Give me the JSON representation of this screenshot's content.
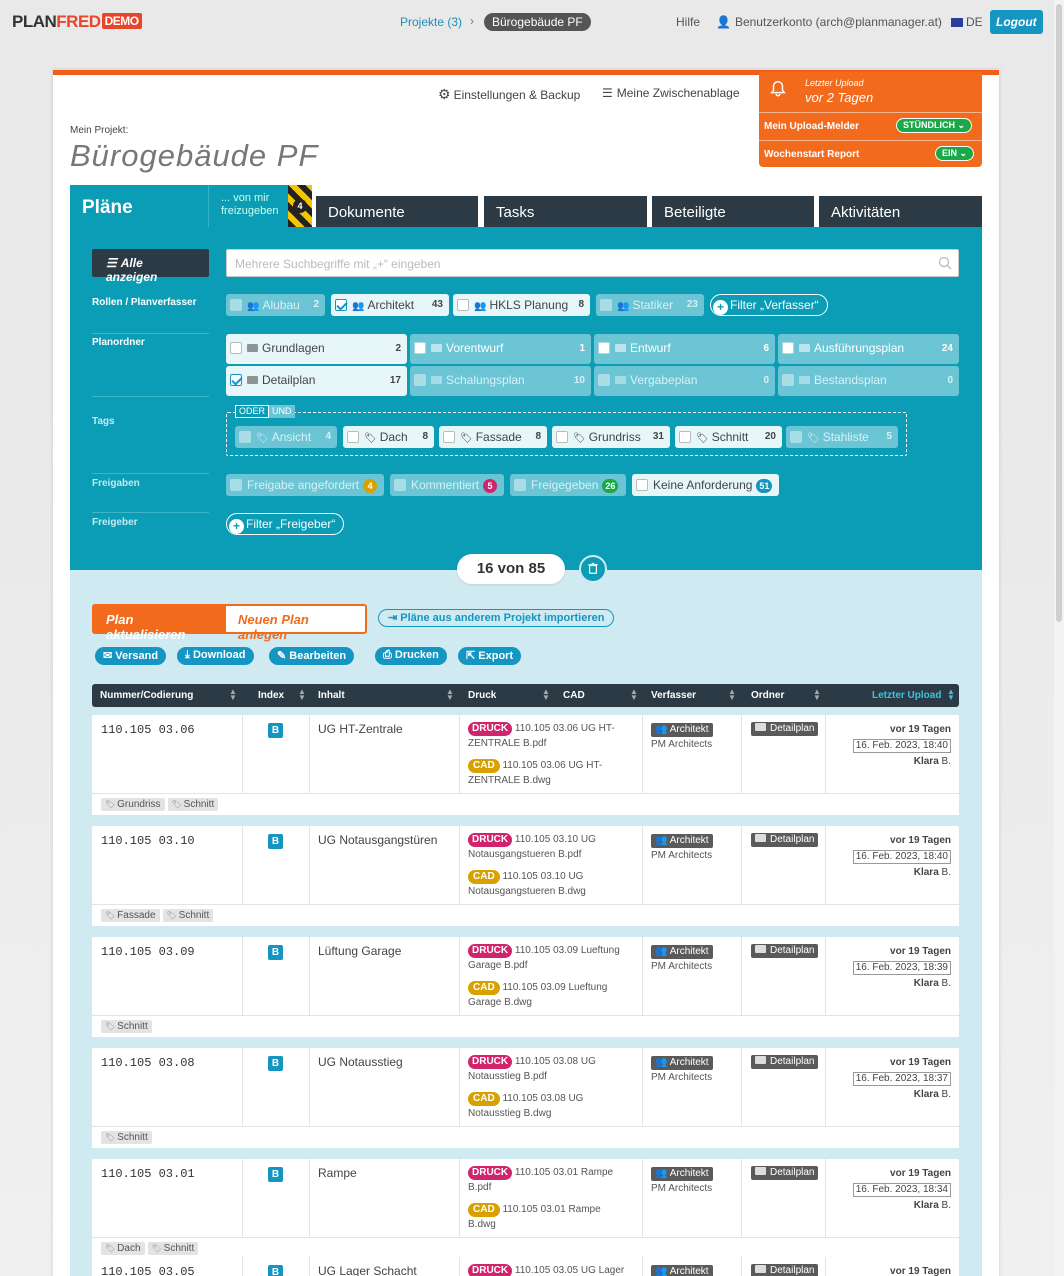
{
  "topbar": {
    "logo_a": "PLAN",
    "logo_b": "FRED",
    "logo_demo": "DEMO",
    "crumb_projects": "Projekte (3)",
    "crumb_current": "Bürogebäude PF",
    "help": "Hilfe",
    "account": "Benutzerkonto (arch@planmanager.at)",
    "lang": "DE",
    "logout": "Logout"
  },
  "toolbar": {
    "settings": "Einstellungen & Backup",
    "clipboard": "Meine Zwischenablage"
  },
  "notify": {
    "last_upload_label": "Letzter Upload",
    "last_upload_value": "vor 2 Tagen",
    "upload_alert_label": "Mein Upload-Melder",
    "upload_alert_value": "STÜNDLICH",
    "weekly_label": "Wochenstart Report",
    "weekly_value": "EIN"
  },
  "project": {
    "label": "Mein Projekt:",
    "title": "Bürogebäude PF"
  },
  "tabs": {
    "plans": "Pläne",
    "release_line1": "... von mir",
    "release_line2": "freizugeben",
    "release_count": "4",
    "documents": "Dokumente",
    "tasks": "Tasks",
    "participants": "Beteiligte",
    "activities": "Aktivitäten"
  },
  "filter": {
    "show_all": "Alle anzeigen",
    "search_placeholder": "Mehrere Suchbegriffe mit „+“ eingeben",
    "roles_label": "Rollen / Planverfasser",
    "roles": [
      {
        "label": "Alubau",
        "count": "2"
      },
      {
        "label": "Architekt",
        "count": "43"
      },
      {
        "label": "HKLS Planung",
        "count": "8"
      },
      {
        "label": "Statiker",
        "count": "23"
      }
    ],
    "add_author_filter": "Filter „Verfasser“",
    "folders_label": "Planordner",
    "folders": [
      {
        "label": "Grundlagen",
        "count": "2"
      },
      {
        "label": "Vorentwurf",
        "count": "1"
      },
      {
        "label": "Entwurf",
        "count": "6"
      },
      {
        "label": "Ausführungsplan",
        "count": "24"
      },
      {
        "label": "Detailplan",
        "count": "17"
      },
      {
        "label": "Schalungsplan",
        "count": "10"
      },
      {
        "label": "Vergabeplan",
        "count": "0"
      },
      {
        "label": "Bestandsplan",
        "count": "0"
      }
    ],
    "tags_label": "Tags",
    "oder": "ODER",
    "und": "UND",
    "tags": [
      {
        "label": "Ansicht",
        "count": "4"
      },
      {
        "label": "Dach",
        "count": "8"
      },
      {
        "label": "Fassade",
        "count": "8"
      },
      {
        "label": "Grundriss",
        "count": "31"
      },
      {
        "label": "Schnitt",
        "count": "20"
      },
      {
        "label": "Stahliste",
        "count": "5"
      }
    ],
    "releases_label": "Freigaben",
    "releases": [
      {
        "label": "Freigabe angefordert",
        "count": "4"
      },
      {
        "label": "Kommentiert",
        "count": "5"
      },
      {
        "label": "Freigegeben",
        "count": "26"
      },
      {
        "label": "Keine Anforderung",
        "count": "51"
      }
    ],
    "releaser_label": "Freigeber",
    "add_releaser_filter": "Filter „Freigeber“"
  },
  "counter": "16 von 85",
  "actions": {
    "update_plan": "Plan aktualisieren",
    "new_plan": "Neuen Plan anlegen",
    "import": "Pläne aus anderem Projekt importieren",
    "send": "Versand",
    "download": "Download",
    "edit": "Bearbeiten",
    "print": "Drucken",
    "export": "Export"
  },
  "table": {
    "headers": {
      "number": "Nummer/Codierung",
      "index": "Index",
      "content": "Inhalt",
      "print": "Druck",
      "cad": "CAD",
      "author": "Verfasser",
      "folder": "Ordner",
      "upload": "Letzter Upload"
    },
    "druck_label": "DRUCK",
    "cad_label": "CAD",
    "rows": [
      {
        "number": "110.105 03.06",
        "index": "B",
        "content": "UG HT-Zentrale",
        "pdf1": "110.105 03.06 UG HT-",
        "pdf2": "ZENTRALE B.pdf",
        "dwg1": "110.105 03.06 UG HT-",
        "dwg2": "ZENTRALE B.dwg",
        "role": "Architekt",
        "company": "PM Architects",
        "folder": "Detailplan",
        "ago": "vor 19 Tagen",
        "date": "16. Feb. 2023, 18:40",
        "user": "Klara",
        "user_b": "B.",
        "tags": [
          "Grundriss",
          "Schnitt"
        ]
      },
      {
        "number": "110.105 03.10",
        "index": "B",
        "content": "UG Notausgangstüren",
        "pdf1": "110.105 03.10 UG",
        "pdf2": "Notausgangstueren B.pdf",
        "dwg1": "110.105 03.10 UG",
        "dwg2": "Notausgangstueren B.dwg",
        "role": "Architekt",
        "company": "PM Architects",
        "folder": "Detailplan",
        "ago": "vor 19 Tagen",
        "date": "16. Feb. 2023, 18:40",
        "user": "Klara",
        "user_b": "B.",
        "tags": [
          "Fassade",
          "Schnitt"
        ]
      },
      {
        "number": "110.105 03.09",
        "index": "B",
        "content": "Lüftung Garage",
        "pdf1": "110.105 03.09 Lueftung",
        "pdf2": "Garage B.pdf",
        "dwg1": "110.105 03.09 Lueftung",
        "dwg2": "Garage B.dwg",
        "role": "Architekt",
        "company": "PM Architects",
        "folder": "Detailplan",
        "ago": "vor 19 Tagen",
        "date": "16. Feb. 2023, 18:39",
        "user": "Klara",
        "user_b": "B.",
        "tags": [
          "Schnitt"
        ]
      },
      {
        "number": "110.105 03.08",
        "index": "B",
        "content": "UG Notausstieg",
        "pdf1": "110.105 03.08 UG",
        "pdf2": "Notausstieg B.pdf",
        "dwg1": "110.105 03.08 UG",
        "dwg2": "Notausstieg B.dwg",
        "role": "Architekt",
        "company": "PM Architects",
        "folder": "Detailplan",
        "ago": "vor 19 Tagen",
        "date": "16. Feb. 2023, 18:37",
        "user": "Klara",
        "user_b": "B.",
        "tags": [
          "Schnitt"
        ]
      },
      {
        "number": "110.105 03.01",
        "index": "B",
        "content": "Rampe",
        "pdf1": "110.105 03.01 Rampe",
        "pdf2": "B.pdf",
        "dwg1": "110.105 03.01 Rampe B.dwg",
        "dwg2": "",
        "role": "Architekt",
        "company": "PM Architects",
        "folder": "Detailplan",
        "ago": "vor 19 Tagen",
        "date": "16. Feb. 2023, 18:34",
        "user": "Klara",
        "user_b": "B.",
        "tags": [
          "Dach",
          "Schnitt"
        ]
      },
      {
        "number": "110.105 03.05",
        "index": "B",
        "content": "UG Lager Schacht",
        "pdf1": "110.105 03.05 UG Lager",
        "pdf2": "",
        "dwg1": "",
        "dwg2": "",
        "role": "Architekt",
        "company": "",
        "folder": "Detailplan",
        "ago": "vor 19 Tagen",
        "date": "",
        "user": "",
        "user_b": "",
        "tags": []
      }
    ]
  }
}
